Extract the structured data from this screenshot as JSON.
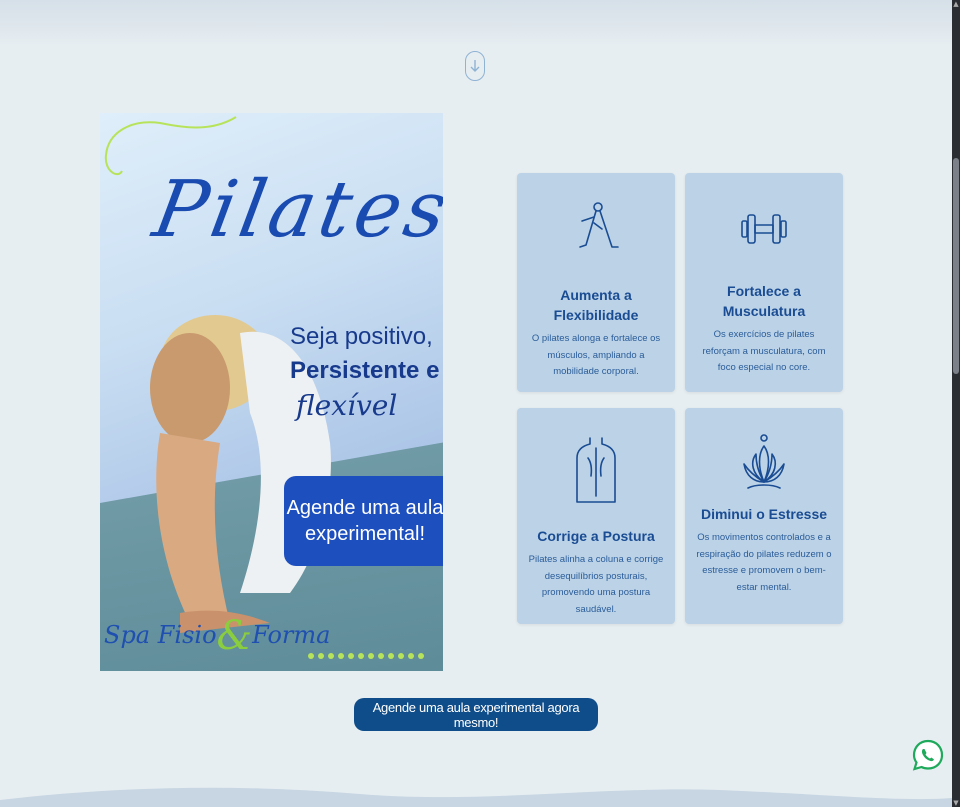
{
  "poster": {
    "title": "Pilates",
    "line1": "Seja positivo,",
    "line2": "Persistente e",
    "line3": "flexível",
    "cta": "Agende uma aula experimental!",
    "logo_left": "Spa Fisio",
    "logo_amp": "&",
    "logo_right": "Forma"
  },
  "benefits": [
    {
      "icon": "yoga-pose-icon",
      "title": "Aumenta a Flexibilidade",
      "text": "O pilates alonga e fortalece os músculos, ampliando a mobilidade corporal."
    },
    {
      "icon": "dumbbell-icon",
      "title": "Fortalece a Musculatura",
      "text": "Os exercícios de pilates reforçam a musculatura, com foco especial no core."
    },
    {
      "icon": "spine-posture-icon",
      "title": "Corrige a Postura",
      "text": "Pilates alinha a coluna e corrige desequilíbrios posturais, promovendo uma postura saudável."
    },
    {
      "icon": "lotus-icon",
      "title": "Diminui o Estresse",
      "text": "Os movimentos controlados e a respiração do pilates reduzem o estresse e promovem o bem-estar mental."
    }
  ],
  "cta_button": "Agende uma aula experimental agora mesmo!",
  "colors": {
    "background": "#e7eef2",
    "card": "#bcd3e7",
    "primary": "#0f4d8a",
    "accent_green": "#8acd3e"
  }
}
